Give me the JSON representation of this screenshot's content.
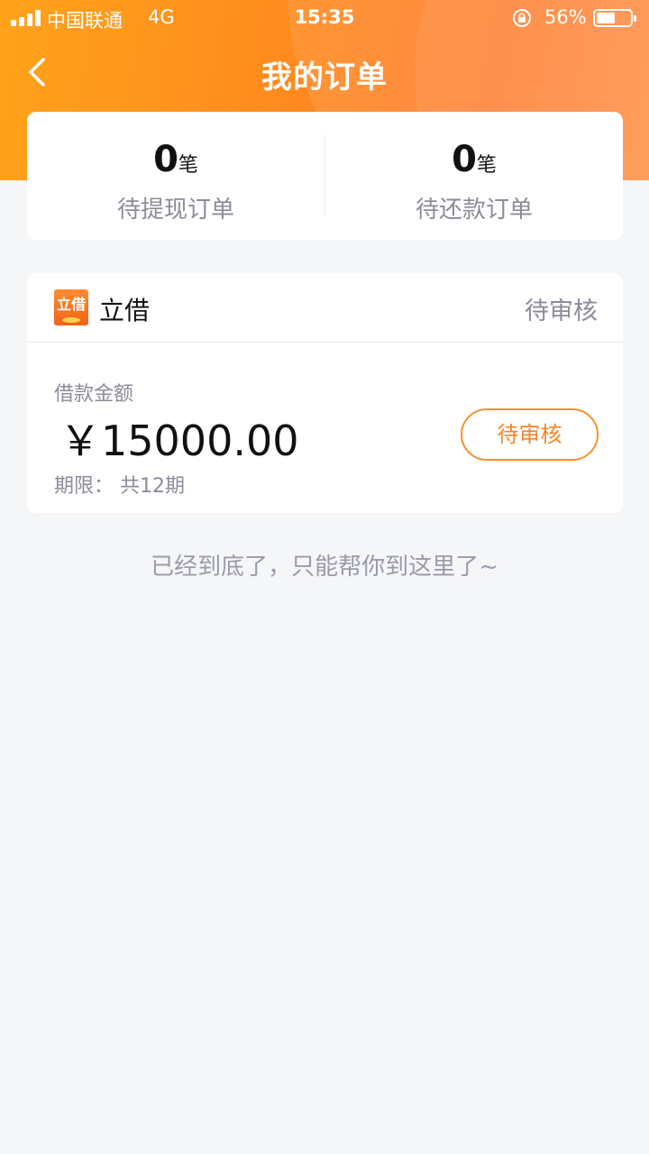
{
  "status_bar": {
    "carrier": "中国联通",
    "network": "4G",
    "time": "15:35",
    "battery_percent": "56%",
    "battery_level": 0.56
  },
  "nav": {
    "title": "我的订单",
    "back_icon": "chevron-left-icon"
  },
  "summary": {
    "pending_withdraw": {
      "count": "0",
      "unit": "笔",
      "label": "待提现订单"
    },
    "pending_repay": {
      "count": "0",
      "unit": "笔",
      "label": "待还款订单"
    }
  },
  "order": {
    "logo_text": "立借",
    "app_name": "立借",
    "status": "待审核",
    "amount_label": "借款金额",
    "amount": "￥15000.00",
    "term": "期限：  共12期",
    "action_label": "待审核"
  },
  "footer": {
    "end_text": "已经到底了，只能帮你到这里了~"
  },
  "colors": {
    "accent": "#ff8a1f",
    "button_border": "#f5922e",
    "background": "#f5f6f8",
    "muted_text": "#8c8c99"
  }
}
